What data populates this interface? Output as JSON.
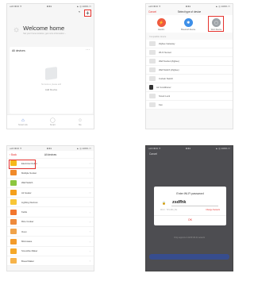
{
  "status_bar": {
    "carrier": "•ull FIDO ✈",
    "time": "9:41",
    "right": "▲ ◎ 100% ▭"
  },
  "home": {
    "welcome_title": "Welcome home",
    "welcome_subtitle": "Set your home location, get more information ›",
    "all_devices": "All devices",
    "more": "···",
    "no_devices": "No devices, please add",
    "add_device": "Add Device",
    "tabs": [
      {
        "label": "Smart Life",
        "icon": "home-icon"
      },
      {
        "label": "Smart",
        "icon": "smart-icon"
      },
      {
        "label": "Me",
        "icon": "me-icon"
      }
    ],
    "scene_icon": "scene-icon",
    "add_icon": "+"
  },
  "select_device": {
    "cancel": "Cancel",
    "title": "Select type of device",
    "categories": [
      {
        "label": "Electric",
        "color": "#ef5a40",
        "glyph": "⚡"
      },
      {
        "label": "Bluetooth Device",
        "color": "#3d8fe8",
        "glyph": "✱"
      },
      {
        "label": "Wi-Fi Device",
        "color": "#9ea3a8",
        "glyph": "▢"
      }
    ],
    "section": "Compatible device",
    "devices": [
      "Zigbee Gateway",
      "Wi-Fi Sensor",
      "Wall Socket (Zigbee)",
      "Wall Switch (Zigbee)",
      "Curtain Switch",
      "Air Conditioner",
      "Smart Lock",
      "Fan"
    ]
  },
  "all_devices_list": {
    "back": "‹ Back",
    "title": "All devices",
    "items": [
      {
        "name": "Electrical Outlet",
        "color": "#f5b81a"
      },
      {
        "name": "Multiple Socket",
        "color": "#f08a2a"
      },
      {
        "name": "Wall Switch",
        "color": "#8cc63f"
      },
      {
        "name": "Air Heater",
        "color": "#f4a01c"
      },
      {
        "name": "Lighting Devices",
        "color": "#f8c637"
      },
      {
        "name": "Kettle",
        "color": "#f2762e"
      },
      {
        "name": "Rice Cooker",
        "color": "#ee8a3c"
      },
      {
        "name": "Oven",
        "color": "#f0a34a"
      },
      {
        "name": "Microwave",
        "color": "#f39b2a"
      },
      {
        "name": "Smoothie Maker",
        "color": "#f5a828"
      },
      {
        "name": "Bread Maker",
        "color": "#f6b34a"
      }
    ]
  },
  "wifi": {
    "cancel": "Cancel",
    "title": "Enter Wi-Fi password",
    "password": "zsdfhk",
    "ssid": "Wi-Fi : TP-LINK_5G",
    "change": "Change Network",
    "ok": "OK",
    "hint": "Only supports 2.4GHz Wi-Fi network"
  }
}
